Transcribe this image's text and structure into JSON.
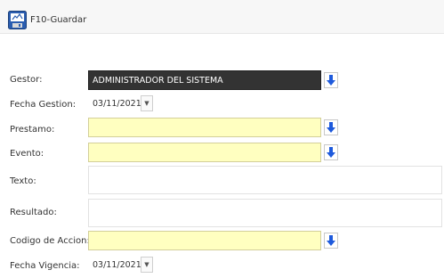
{
  "toolbar": {
    "save_label": "F10-Guardar",
    "save_icon": "save-icon"
  },
  "form": {
    "gestor": {
      "label": "Gestor:",
      "value": "ADMINISTRADOR DEL SISTEMA"
    },
    "fecha_gestion": {
      "label": "Fecha Gestion:",
      "value": "03/11/2021"
    },
    "prestamo": {
      "label": "Prestamo:",
      "value": ""
    },
    "evento": {
      "label": "Evento:",
      "value": ""
    },
    "texto": {
      "label": "Texto:",
      "value": ""
    },
    "resultado": {
      "label": "Resultado:",
      "value": ""
    },
    "codigo_accion": {
      "label": "Codigo de Accion:",
      "value": ""
    },
    "fecha_vigencia": {
      "label": "Fecha Vigencia:",
      "value": "03/11/2021"
    }
  },
  "colors": {
    "required_bg": "#ffffc0",
    "lookup_arrow": "#1e5adc",
    "dark_field_bg": "#333333"
  }
}
